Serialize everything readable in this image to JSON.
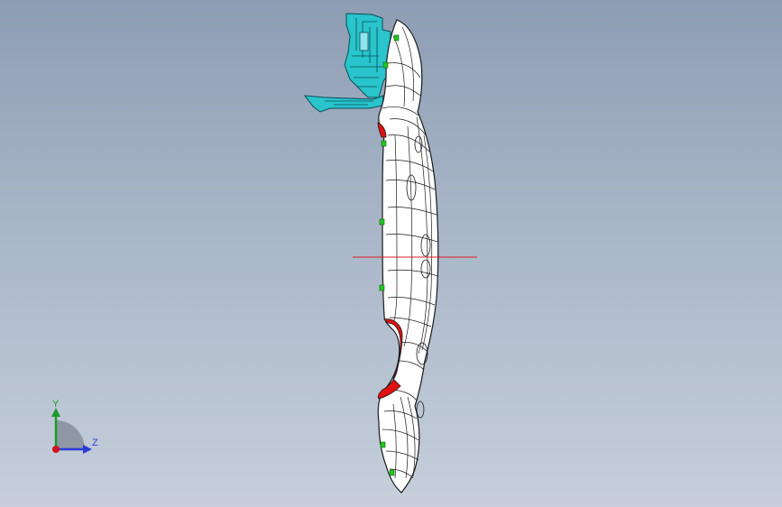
{
  "viewport": {
    "background_top": "#8d9db3",
    "background_bottom": "#c6cfdb"
  },
  "model": {
    "part_color": "#ffffff",
    "edge_color": "#1a1a1a",
    "bracket_color": "#29c4cc",
    "highlight_color": "#e01010",
    "marker_color": "#22c71f",
    "reference_line_color": "#d42020"
  },
  "triad": {
    "y_label": "Y",
    "z_label": "Z",
    "y_color": "#1c9a2b",
    "z_color": "#2b3bd6",
    "x_color": "#d0141b"
  }
}
